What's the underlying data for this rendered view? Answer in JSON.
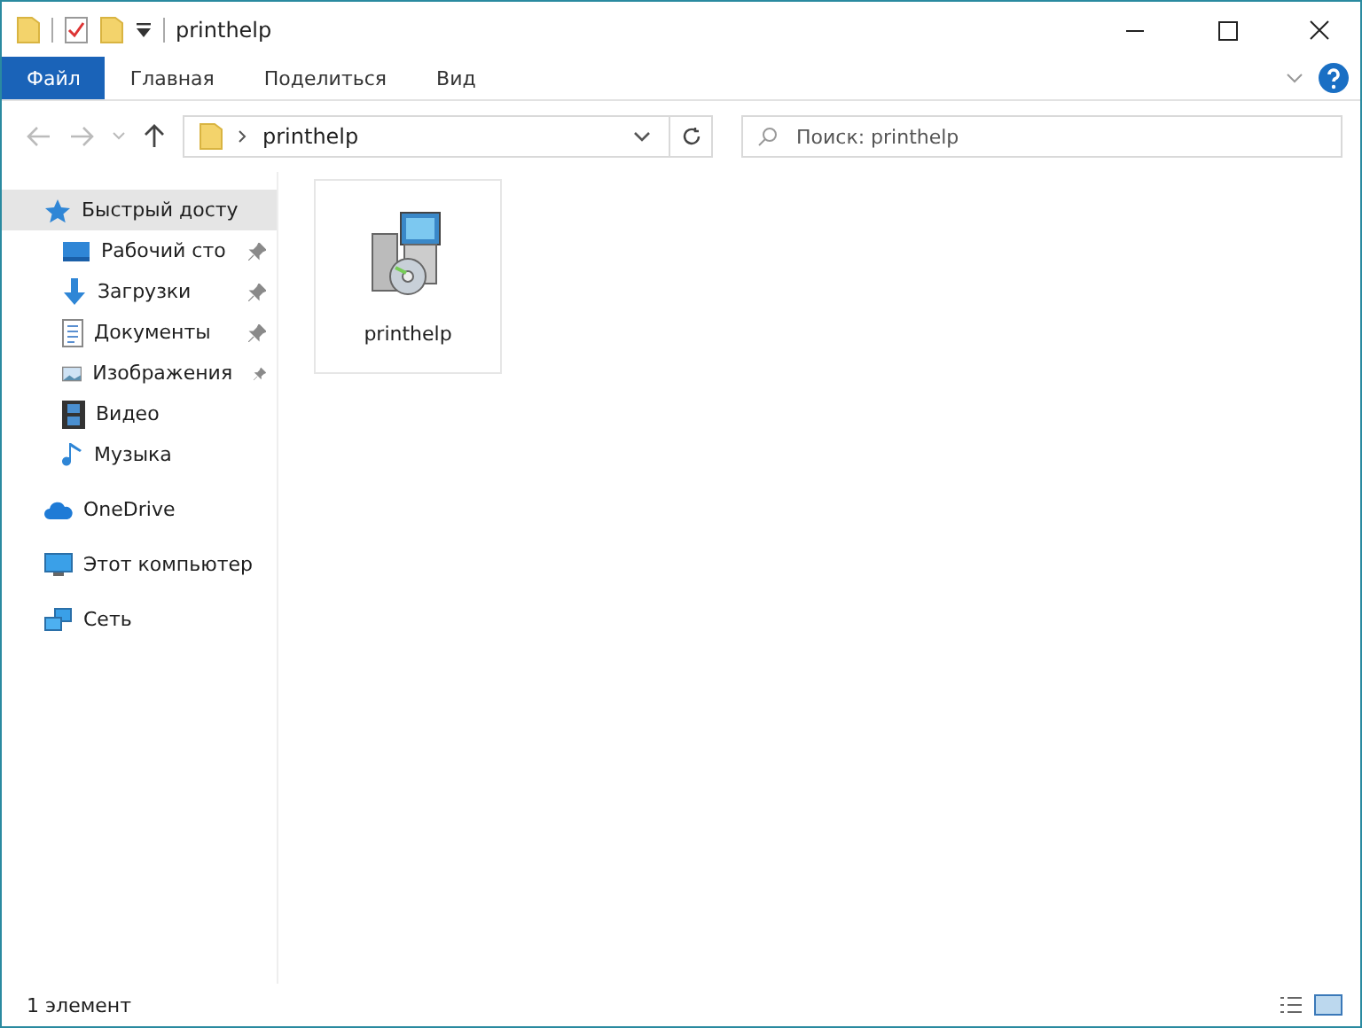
{
  "window": {
    "title": "printhelp"
  },
  "ribbon_tabs": [
    {
      "label": "Файл",
      "kind": "file",
      "selected": false
    },
    {
      "label": "Главная",
      "kind": "tab",
      "selected": false
    },
    {
      "label": "Поделиться",
      "kind": "tab",
      "selected": false
    },
    {
      "label": "Вид",
      "kind": "tab",
      "selected": false
    }
  ],
  "address_bar": {
    "path": "printhelp"
  },
  "search": {
    "placeholder": "Поиск: printhelp"
  },
  "sidebar": {
    "items": [
      {
        "label": "Быстрый досту",
        "selected": true,
        "children": [
          {
            "label": "Рабочий сто",
            "pinned": true
          },
          {
            "label": "Загрузки",
            "pinned": true
          },
          {
            "label": "Документы",
            "pinned": true
          },
          {
            "label": "Изображения",
            "pinned": true
          },
          {
            "label": "Видео",
            "pinned": false
          },
          {
            "label": "Музыка",
            "pinned": false
          }
        ]
      },
      {
        "label": "OneDrive",
        "selected": false
      },
      {
        "label": "Этот компьютер",
        "selected": false
      },
      {
        "label": "Сеть",
        "selected": false
      }
    ]
  },
  "files": [
    {
      "name": "printhelp",
      "selected": false
    }
  ],
  "status_bar": {
    "text": "1 элемент"
  }
}
